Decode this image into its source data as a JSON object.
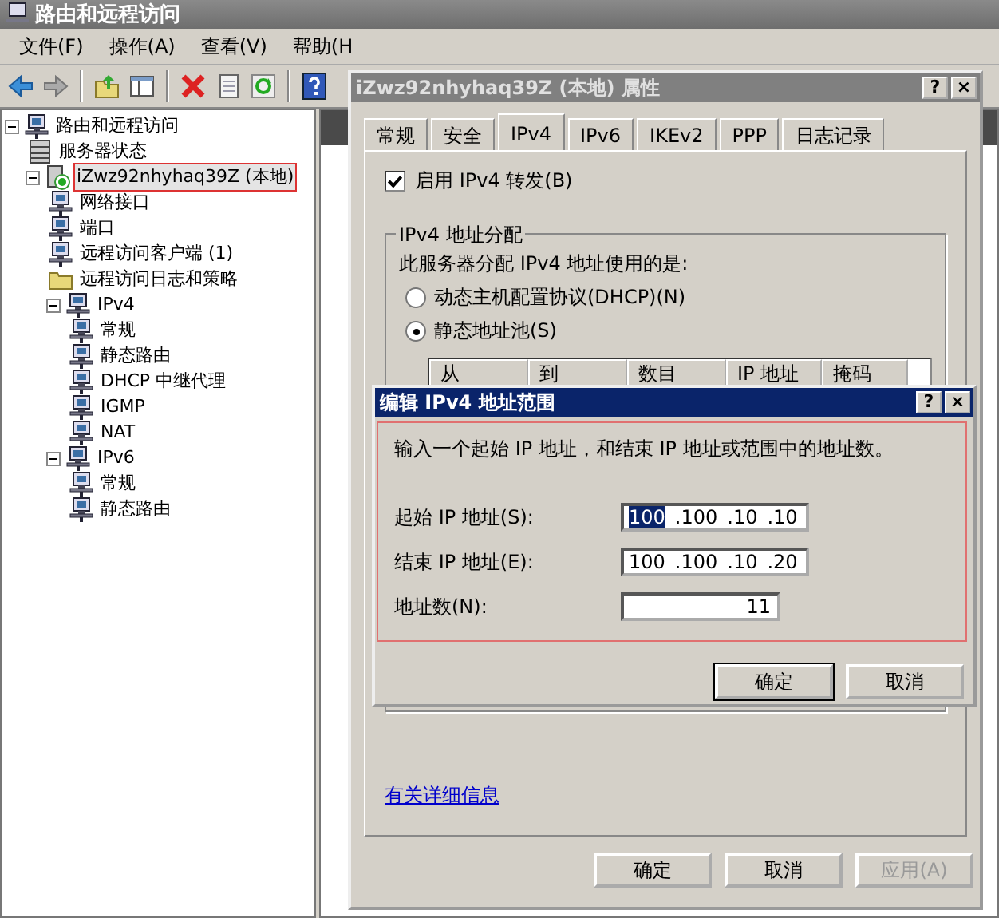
{
  "window": {
    "title": "路由和远程访问"
  },
  "menu": [
    "文件(F)",
    "操作(A)",
    "查看(V)",
    "帮助(H"
  ],
  "toolbar": [
    {
      "kind": "back"
    },
    {
      "kind": "forward"
    },
    {
      "kind": "sep"
    },
    {
      "kind": "up"
    },
    {
      "kind": "tree"
    },
    {
      "kind": "sep"
    },
    {
      "kind": "delete"
    },
    {
      "kind": "properties"
    },
    {
      "kind": "refresh"
    },
    {
      "kind": "sep"
    },
    {
      "kind": "help"
    }
  ],
  "tree": [
    {
      "label": "路由和远程访问",
      "kind": "computer",
      "selected": false,
      "expanded": true,
      "children": [
        {
          "label": "服务器状态",
          "kind": "server",
          "selected": false
        },
        {
          "label": "iZwz92nhyhaq39Z (本地)",
          "kind": "node",
          "selected": true,
          "expanded": true,
          "children": [
            {
              "label": "网络接口",
              "kind": "computer",
              "selected": false
            },
            {
              "label": "端口",
              "kind": "computer",
              "selected": false
            },
            {
              "label": "远程访问客户端 (1)",
              "kind": "computer",
              "selected": false
            },
            {
              "label": "远程访问日志和策略",
              "kind": "folder",
              "selected": false
            },
            {
              "label": "IPv4",
              "kind": "computer",
              "selected": false,
              "expanded": true,
              "children": [
                {
                  "label": "常规",
                  "kind": "computer",
                  "selected": false
                },
                {
                  "label": "静态路由",
                  "kind": "computer",
                  "selected": false
                },
                {
                  "label": "DHCP 中继代理",
                  "kind": "computer",
                  "selected": false
                },
                {
                  "label": "IGMP",
                  "kind": "computer",
                  "selected": false
                },
                {
                  "label": "NAT",
                  "kind": "computer",
                  "selected": false
                }
              ]
            },
            {
              "label": "IPv6",
              "kind": "computer",
              "selected": false,
              "expanded": true,
              "children": [
                {
                  "label": "常规",
                  "kind": "computer",
                  "selected": false
                },
                {
                  "label": "静态路由",
                  "kind": "computer",
                  "selected": false
                }
              ]
            }
          ]
        }
      ]
    }
  ],
  "properties_dialog": {
    "title": "iZwz92nhyhaq39Z (本地) 属性",
    "title_buttons": [
      "?",
      "×"
    ],
    "tabs": [
      {
        "label": "常规",
        "selected": false
      },
      {
        "label": "安全",
        "selected": false
      },
      {
        "label": "IPv4",
        "selected": true
      },
      {
        "label": "IPv6",
        "selected": false
      },
      {
        "label": "IKEv2",
        "selected": false
      },
      {
        "label": "PPP",
        "selected": false
      },
      {
        "label": "日志记录",
        "selected": false
      }
    ],
    "forwarding": {
      "label": "启用 IPv4 转发(B)",
      "checked": true
    },
    "group": {
      "title": "IPv4 地址分配",
      "description": "此服务器分配 IPv4 地址使用的是:",
      "options": [
        {
          "label": "动态主机配置协议(DHCP)(N)",
          "selected": false
        },
        {
          "label": "静态地址池(S)",
          "selected": true
        }
      ],
      "table": {
        "columns": [
          "从",
          "到",
          "数目",
          "IP 地址",
          "掩码"
        ]
      }
    },
    "link": "有关详细信息",
    "buttons": [
      {
        "label": "确定",
        "disabled": false
      },
      {
        "label": "取消",
        "disabled": false
      },
      {
        "label": "应用(A)",
        "disabled": true
      }
    ]
  },
  "range_dialog": {
    "title": "编辑 IPv4 地址范围",
    "title_buttons": [
      "?",
      "×"
    ],
    "instruction": "输入一个起始 IP 地址，和结束 IP 地址或范围中的地址数。",
    "fields": [
      {
        "kind": "ip",
        "label": "起始 IP 地址(S):",
        "octets": [
          {
            "text": "100",
            "selected": true
          },
          {
            "text": ".100",
            "selected": false
          },
          {
            "text": ".10",
            "selected": false
          },
          {
            "text": ".10",
            "selected": false
          }
        ]
      },
      {
        "kind": "ip",
        "label": "结束 IP 地址(E):",
        "octets": [
          {
            "text": "100",
            "selected": false
          },
          {
            "text": ".100",
            "selected": false
          },
          {
            "text": ".10",
            "selected": false
          },
          {
            "text": ".20",
            "selected": false
          }
        ]
      },
      {
        "kind": "number",
        "label": "地址数(N):",
        "value": "11"
      }
    ],
    "buttons": [
      "确定",
      "取消"
    ]
  }
}
